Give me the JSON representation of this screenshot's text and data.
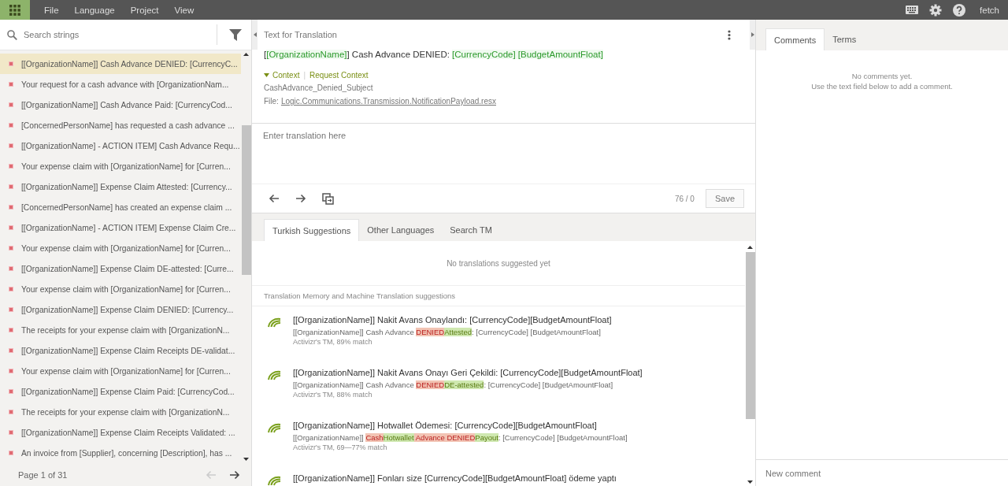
{
  "menu": [
    "File",
    "Language",
    "Project",
    "View"
  ],
  "user": "fetch",
  "search": {
    "placeholder": "Search strings"
  },
  "strings": [
    {
      "text": "[[OrganizationName]] Cash Advance DENIED: [CurrencyC...",
      "selected": true
    },
    {
      "text": "Your request for a cash advance with [OrganizationNam...",
      "selected": false
    },
    {
      "text": "[[OrganizationName]] Cash Advance Paid: [CurrencyCod...",
      "selected": false
    },
    {
      "text": "[ConcernedPersonName] has requested a cash advance ...",
      "selected": false
    },
    {
      "text": "[[OrganizationName] - ACTION ITEM] Cash Advance Requ...",
      "selected": false
    },
    {
      "text": "Your expense claim with [OrganizationName] for [Curren...",
      "selected": false
    },
    {
      "text": "[[OrganizationName]] Expense Claim Attested: [Currency...",
      "selected": false
    },
    {
      "text": "[ConcernedPersonName] has created an expense claim ...",
      "selected": false
    },
    {
      "text": "[[OrganizationName] - ACTION ITEM] Expense Claim Cre...",
      "selected": false
    },
    {
      "text": "Your expense claim with [OrganizationName] for [Curren...",
      "selected": false
    },
    {
      "text": "[[OrganizationName]] Expense Claim DE-attested: [Curre...",
      "selected": false
    },
    {
      "text": "Your expense claim with [OrganizationName] for [Curren...",
      "selected": false
    },
    {
      "text": "[[OrganizationName]] Expense Claim DENIED: [Currency...",
      "selected": false
    },
    {
      "text": "The receipts for your expense claim with [OrganizationN...",
      "selected": false
    },
    {
      "text": "[[OrganizationName]] Expense Claim Receipts DE-validat...",
      "selected": false
    },
    {
      "text": "Your expense claim with [OrganizationName] for [Curren...",
      "selected": false
    },
    {
      "text": "[[OrganizationName]] Expense Claim Paid: [CurrencyCod...",
      "selected": false
    },
    {
      "text": "The receipts for your expense claim with [OrganizationN...",
      "selected": false
    },
    {
      "text": "[[OrganizationName]] Expense Claim Receipts Validated: ...",
      "selected": false
    },
    {
      "text": "An invoice from [Supplier], concerning [Description], has ...",
      "selected": false
    }
  ],
  "pager": {
    "label": "Page 1 of 31",
    "prev_disabled": true
  },
  "source": {
    "heading": "Text for Translation",
    "segments": [
      {
        "kind": "text",
        "text": "["
      },
      {
        "kind": "tag",
        "text": "[OrganizationName]"
      },
      {
        "kind": "text",
        "text": "] Cash Advance DENIED: "
      },
      {
        "kind": "tag",
        "text": "[CurrencyCode] "
      },
      {
        "kind": "tag",
        "text": "[BudgetAmountFloat]"
      }
    ],
    "context_link": "Context",
    "context_separator": "|",
    "request_link": "Request Context",
    "key": "CashAdvance_Denied_Subject",
    "file_label": "File:",
    "file": "Logic.Communications.Transmission.NotificationPayload.resx"
  },
  "translation": {
    "placeholder": "Enter translation here",
    "counter": "76 / 0",
    "save": "Save"
  },
  "suggestion_tabs": [
    {
      "label": "Turkish Suggestions",
      "selected": true
    },
    {
      "label": "Other Languages",
      "selected": false
    },
    {
      "label": "Search TM",
      "selected": false
    }
  ],
  "no_suggestions": "No translations suggested yet",
  "tm_heading": "Translation Memory and Machine Translation suggestions",
  "suggestions": [
    {
      "translation": "[[OrganizationName]] Nakit Avans Onaylandı: [CurrencyCode][BudgetAmountFloat]",
      "source": [
        {
          "kind": "plain",
          "text": "[[OrganizationName]] Cash Advance "
        },
        {
          "kind": "removed",
          "text": "DENIED"
        },
        {
          "kind": "added",
          "text": "Attested"
        },
        {
          "kind": "plain",
          "text": ": [CurrencyCode] [BudgetAmountFloat]"
        }
      ],
      "meta": "Activizr's TM, 89% match"
    },
    {
      "translation": "[[OrganizationName]] Nakit Avans Onayı Geri Çekildi: [CurrencyCode][BudgetAmountFloat]",
      "source": [
        {
          "kind": "plain",
          "text": "[[OrganizationName]] Cash Advance "
        },
        {
          "kind": "removed",
          "text": "DENIED"
        },
        {
          "kind": "added",
          "text": "DE-attested"
        },
        {
          "kind": "plain",
          "text": ": [CurrencyCode] [BudgetAmountFloat]"
        }
      ],
      "meta": "Activizr's TM, 88% match"
    },
    {
      "translation": "[[OrganizationName]] Hotwallet Ödemesi: [CurrencyCode][BudgetAmountFloat]",
      "source": [
        {
          "kind": "plain",
          "text": "[[OrganizationName]] "
        },
        {
          "kind": "removed",
          "text": "Cash"
        },
        {
          "kind": "added",
          "text": "Hotwallet"
        },
        {
          "kind": "removed",
          "text": " Advance DENIED"
        },
        {
          "kind": "added",
          "text": "Payout"
        },
        {
          "kind": "plain",
          "text": ": [CurrencyCode] [BudgetAmountFloat]"
        }
      ],
      "meta": "Activizr's TM, 69—77% match"
    },
    {
      "translation": "[[OrganizationName]] Fonları size [CurrencyCode][BudgetAmountFloat] ödeme yaptı"
    }
  ],
  "side_tabs": [
    {
      "label": "Comments",
      "selected": true
    },
    {
      "label": "Terms",
      "selected": false
    }
  ],
  "comments_empty": [
    "No comments yet.",
    "Use the text field below to add a comment."
  ],
  "new_comment": {
    "placeholder": "New comment"
  }
}
